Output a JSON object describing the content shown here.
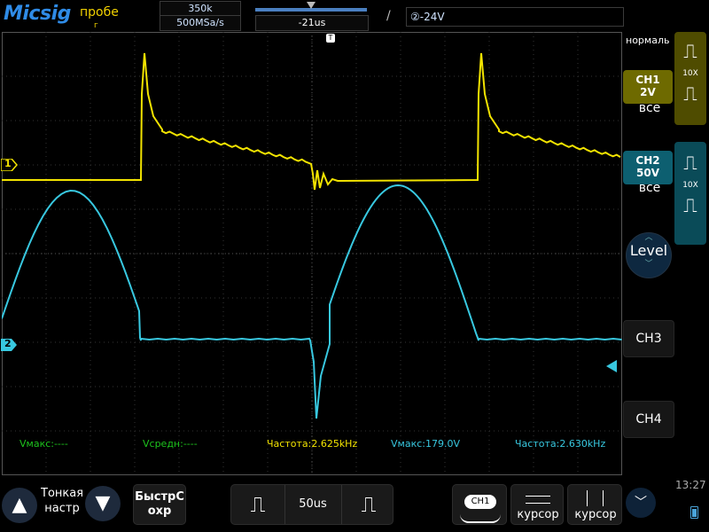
{
  "brand": "Micsig",
  "mode_label": "пробе",
  "mode_label_2": "г",
  "memory_depth": "350k",
  "sample_rate": "500MSa/s",
  "time_position": "-21us",
  "trigger": {
    "slope": "/",
    "level": "②-24V"
  },
  "trigger_mode": "нормаль",
  "ch1": {
    "name": "CH1",
    "scale": "2V",
    "coupling": "все",
    "probe": "10X",
    "color": "#f2e300"
  },
  "ch2": {
    "name": "CH2",
    "scale": "50V",
    "coupling": "все",
    "probe": "10X",
    "color": "#38c8e0"
  },
  "level_btn": "Level",
  "ch3_btn": "CH3",
  "ch4_btn": "CH4",
  "ch_markers": {
    "ch1": "1",
    "ch2": "2"
  },
  "measurements": {
    "ch1_vmax": "Vмакс:----",
    "ch1_vavg": "Vсредн:----",
    "ch1_freq": "Частота:2.625kHz",
    "ch2_vmax": "Vмакс:179.0V",
    "ch2_freq": "Частота:2.630kHz"
  },
  "bottom": {
    "fine_label": "Тонкая настр",
    "quick_save_line1": "БыстрС",
    "quick_save_line2": "охр",
    "timebase": "50us",
    "cursor_ch": "CH1",
    "cursor1_label": "курсор",
    "cursor2_label": "курсор",
    "time": "13:27"
  },
  "icons": [
    "arrow-up-icon",
    "arrow-down-icon",
    "pulse-narrow-icon",
    "pulse-wide-icon",
    "chevron-down-icon",
    "battery-icon",
    "trigger-marker-icon"
  ]
}
